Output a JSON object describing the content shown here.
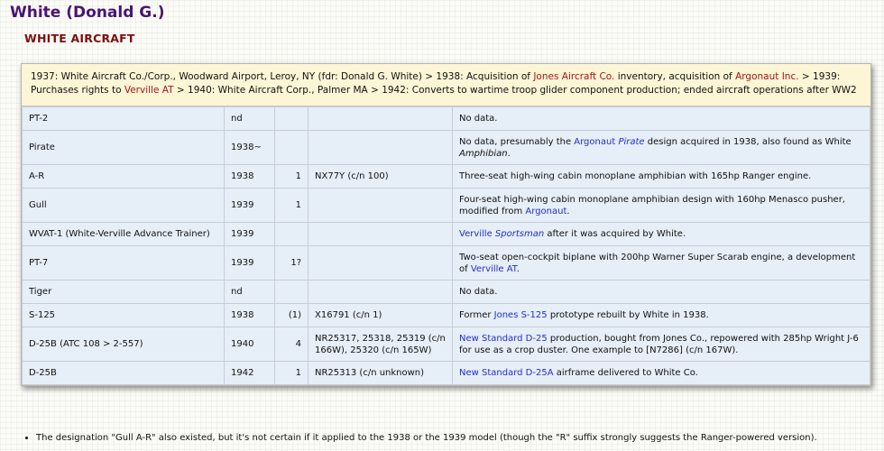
{
  "header": {
    "title": "White (Donald G.)",
    "subtitle": "WHITE AIRCRAFT"
  },
  "intro": {
    "t1": "1937: White Aircraft Co./Corp., Woodward Airport, Leroy, NY (fdr: Donald G. White) > 1938: Acquisition of ",
    "l1": "Jones Aircraft Co.",
    "t2": " inventory, acquisition of ",
    "l2": "Argonaut Inc.",
    "t3": " > 1939: Purchases rights to ",
    "l3": "Verville AT",
    "t4": " > 1940: White Aircraft Corp., Palmer MA > 1942: Converts to wartime troop glider component production; ended aircraft operations after WW2"
  },
  "rows": [
    {
      "model": "PT-2",
      "year": "nd",
      "qty": "",
      "reg": "",
      "desc": {
        "a": "No data."
      }
    },
    {
      "model": "Pirate",
      "year": "1938~",
      "qty": "",
      "reg": "",
      "desc": {
        "a": "No data, presumably the ",
        "l1": "Argonaut ",
        "l1i": "Pirate",
        "b": " design acquired in 1938, also found as White ",
        "bi": "Amphibian",
        "c": "."
      }
    },
    {
      "model": "A-R",
      "year": "1938",
      "qty": "1",
      "reg": "NX77Y (c/n 100)",
      "desc": {
        "a": "Three-seat high-wing cabin monoplane amphibian with 165hp Ranger engine."
      }
    },
    {
      "model": "Gull",
      "year": "1939",
      "qty": "1",
      "reg": "",
      "desc": {
        "a": "Four-seat high-wing cabin monoplane amphibian design with 160hp Menasco pusher, modified from ",
        "l1": "Argonaut",
        "c": "."
      }
    },
    {
      "model": "WVAT-1 (White-Verville Advance Trainer)",
      "year": "1939",
      "qty": "",
      "reg": "",
      "desc": {
        "l1": "Verville ",
        "l1i": "Sportsman",
        "b": " after it was acquired by White."
      }
    },
    {
      "model": "PT-7",
      "year": "1939",
      "qty": "1?",
      "reg": "",
      "desc": {
        "a": "Two-seat open-cockpit biplane with 200hp Warner Super Scarab engine, a development of ",
        "l1": "Verville AT",
        "c": "."
      }
    },
    {
      "model": "Tiger",
      "year": "nd",
      "qty": "",
      "reg": "",
      "desc": {
        "a": "No data."
      }
    },
    {
      "model": "S-125",
      "year": "1938",
      "qty": "(1)",
      "reg": "X16791 (c/n 1)",
      "desc": {
        "a": "Former ",
        "l1": "Jones S-125",
        "b": " prototype rebuilt by White in 1938."
      }
    },
    {
      "model": "D-25B (ATC 108 > 2-557)",
      "year": "1940",
      "qty": "4",
      "reg": "NR25317, 25318, 25319 (c/n 166W), 25320 (c/n 165W)",
      "desc": {
        "l1": "New Standard D-25",
        "b": " production, bought from Jones Co., repowered with 285hp Wright J-6 for use as a crop duster. One example to [N7286] (c/n 167W)."
      }
    },
    {
      "model": "D-25B",
      "year": "1942",
      "qty": "1",
      "reg": "NR25313 (c/n unknown)",
      "desc": {
        "l1": "New Standard D-25A",
        "b": " airframe delivered to White Co."
      }
    }
  ],
  "notes": [
    "The designation \"Gull A-R\" also existed, but it's not certain if it applied to the 1938 or the 1939 model (though the \"R\" suffix strongly suggests the Ranger-powered version)."
  ]
}
